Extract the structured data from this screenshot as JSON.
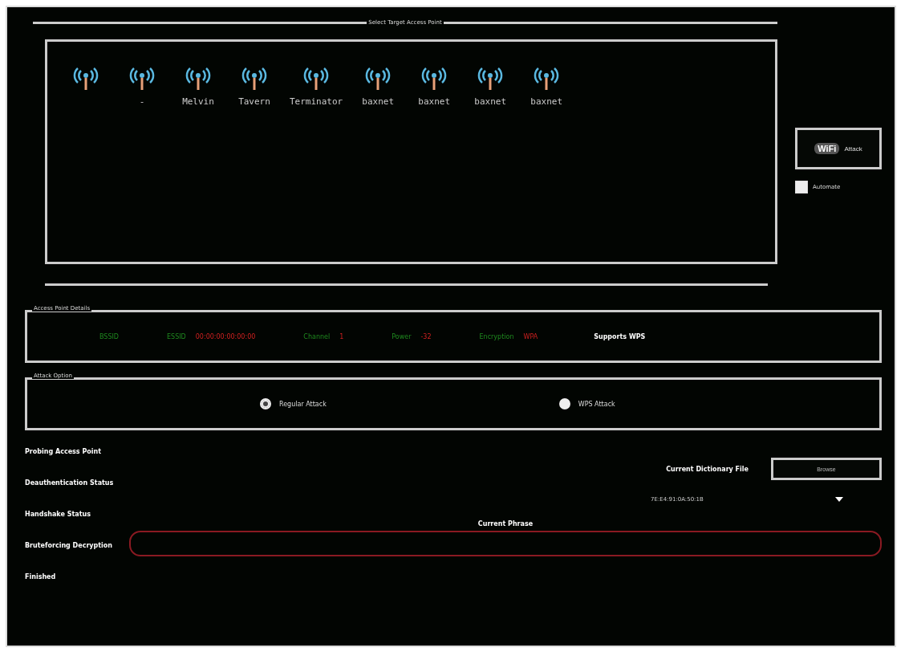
{
  "target_section": {
    "title": "Select Target Access Point"
  },
  "access_points": [
    {
      "selected": false
    },
    {
      "label": "-",
      "selected": false
    },
    {
      "label": "Melvin",
      "selected": false
    },
    {
      "label": "Tavern",
      "selected": false
    },
    {
      "label": "Terminator",
      "selected": false
    },
    {
      "label": "baxnet",
      "selected": false
    },
    {
      "label": "baxnet",
      "selected": false
    },
    {
      "label": "baxnet",
      "selected": false
    },
    {
      "label": "baxnet",
      "selected": false
    }
  ],
  "attack_button": {
    "label": "Attack",
    "logo": "WiFi"
  },
  "automate": {
    "label": "Automate",
    "checked": false
  },
  "details": {
    "title": "Access Point Details",
    "fields": [
      {
        "label": "BSSID"
      },
      {
        "label": "ESSID",
        "value": "00:00:00:00:00:00"
      },
      {
        "label": "Channel",
        "value": "1"
      },
      {
        "label": "Power",
        "value": "-32"
      },
      {
        "label": "Encryption",
        "value": "WPA"
      }
    ],
    "wps_note": "Supports WPS"
  },
  "attack_options": {
    "title": "Attack Option",
    "options": [
      {
        "label": "Regular Attack",
        "selected": true
      },
      {
        "label": "WPS Attack",
        "selected": false
      }
    ]
  },
  "statuses": [
    {
      "label": "Probing Access Point"
    },
    {
      "label": "Deauthentication Status"
    },
    {
      "label": "Handshake Status"
    },
    {
      "label": "Bruteforcing Decryption"
    },
    {
      "label": "Finished"
    }
  ],
  "dictionary": {
    "label": "Current Dictionary File",
    "button": "Browse"
  },
  "client_select": {
    "value": "7E:E4:91:0A:50:1B"
  },
  "current_phrase": {
    "label": "Current Phrase"
  }
}
